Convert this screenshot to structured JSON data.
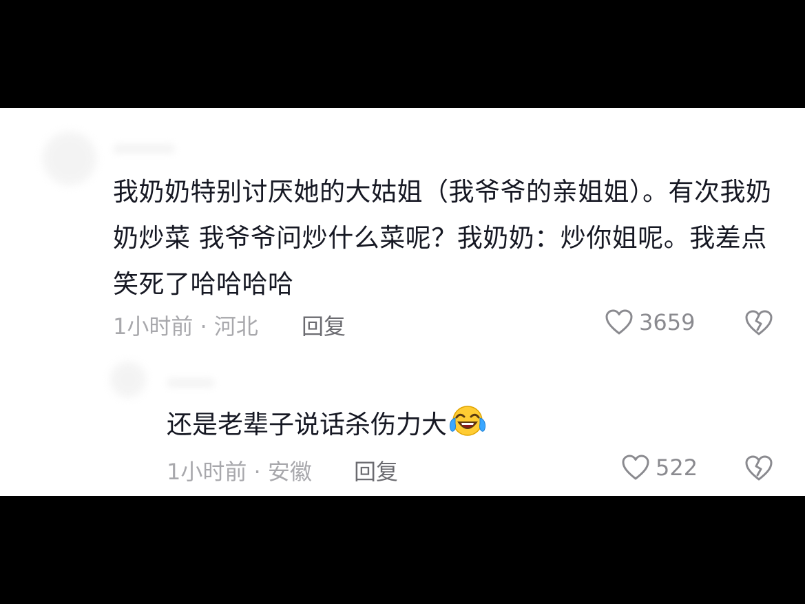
{
  "comments": [
    {
      "text": "我奶奶特别讨厌她的大姑姐（我爷爷的亲姐姐）。有次我奶奶炒菜 我爷爷问炒什么菜呢？我奶奶：炒你姐呢。我差点笑死了哈哈哈哈",
      "time_location": "1小时前 · 河北",
      "reply_label": "回复",
      "likes": "3659"
    }
  ],
  "replies": [
    {
      "text": "还是老辈子说话杀伤力大",
      "emoji": "loudly-crying-laughing-face-icon",
      "time_location": "1小时前 · 安徽",
      "reply_label": "回复",
      "likes": "522"
    }
  ],
  "colors": {
    "text": "#161823",
    "meta": "#a8a8ac",
    "icon": "#8a8a8f",
    "background": "#ffffff",
    "letterbox": "#000000"
  }
}
